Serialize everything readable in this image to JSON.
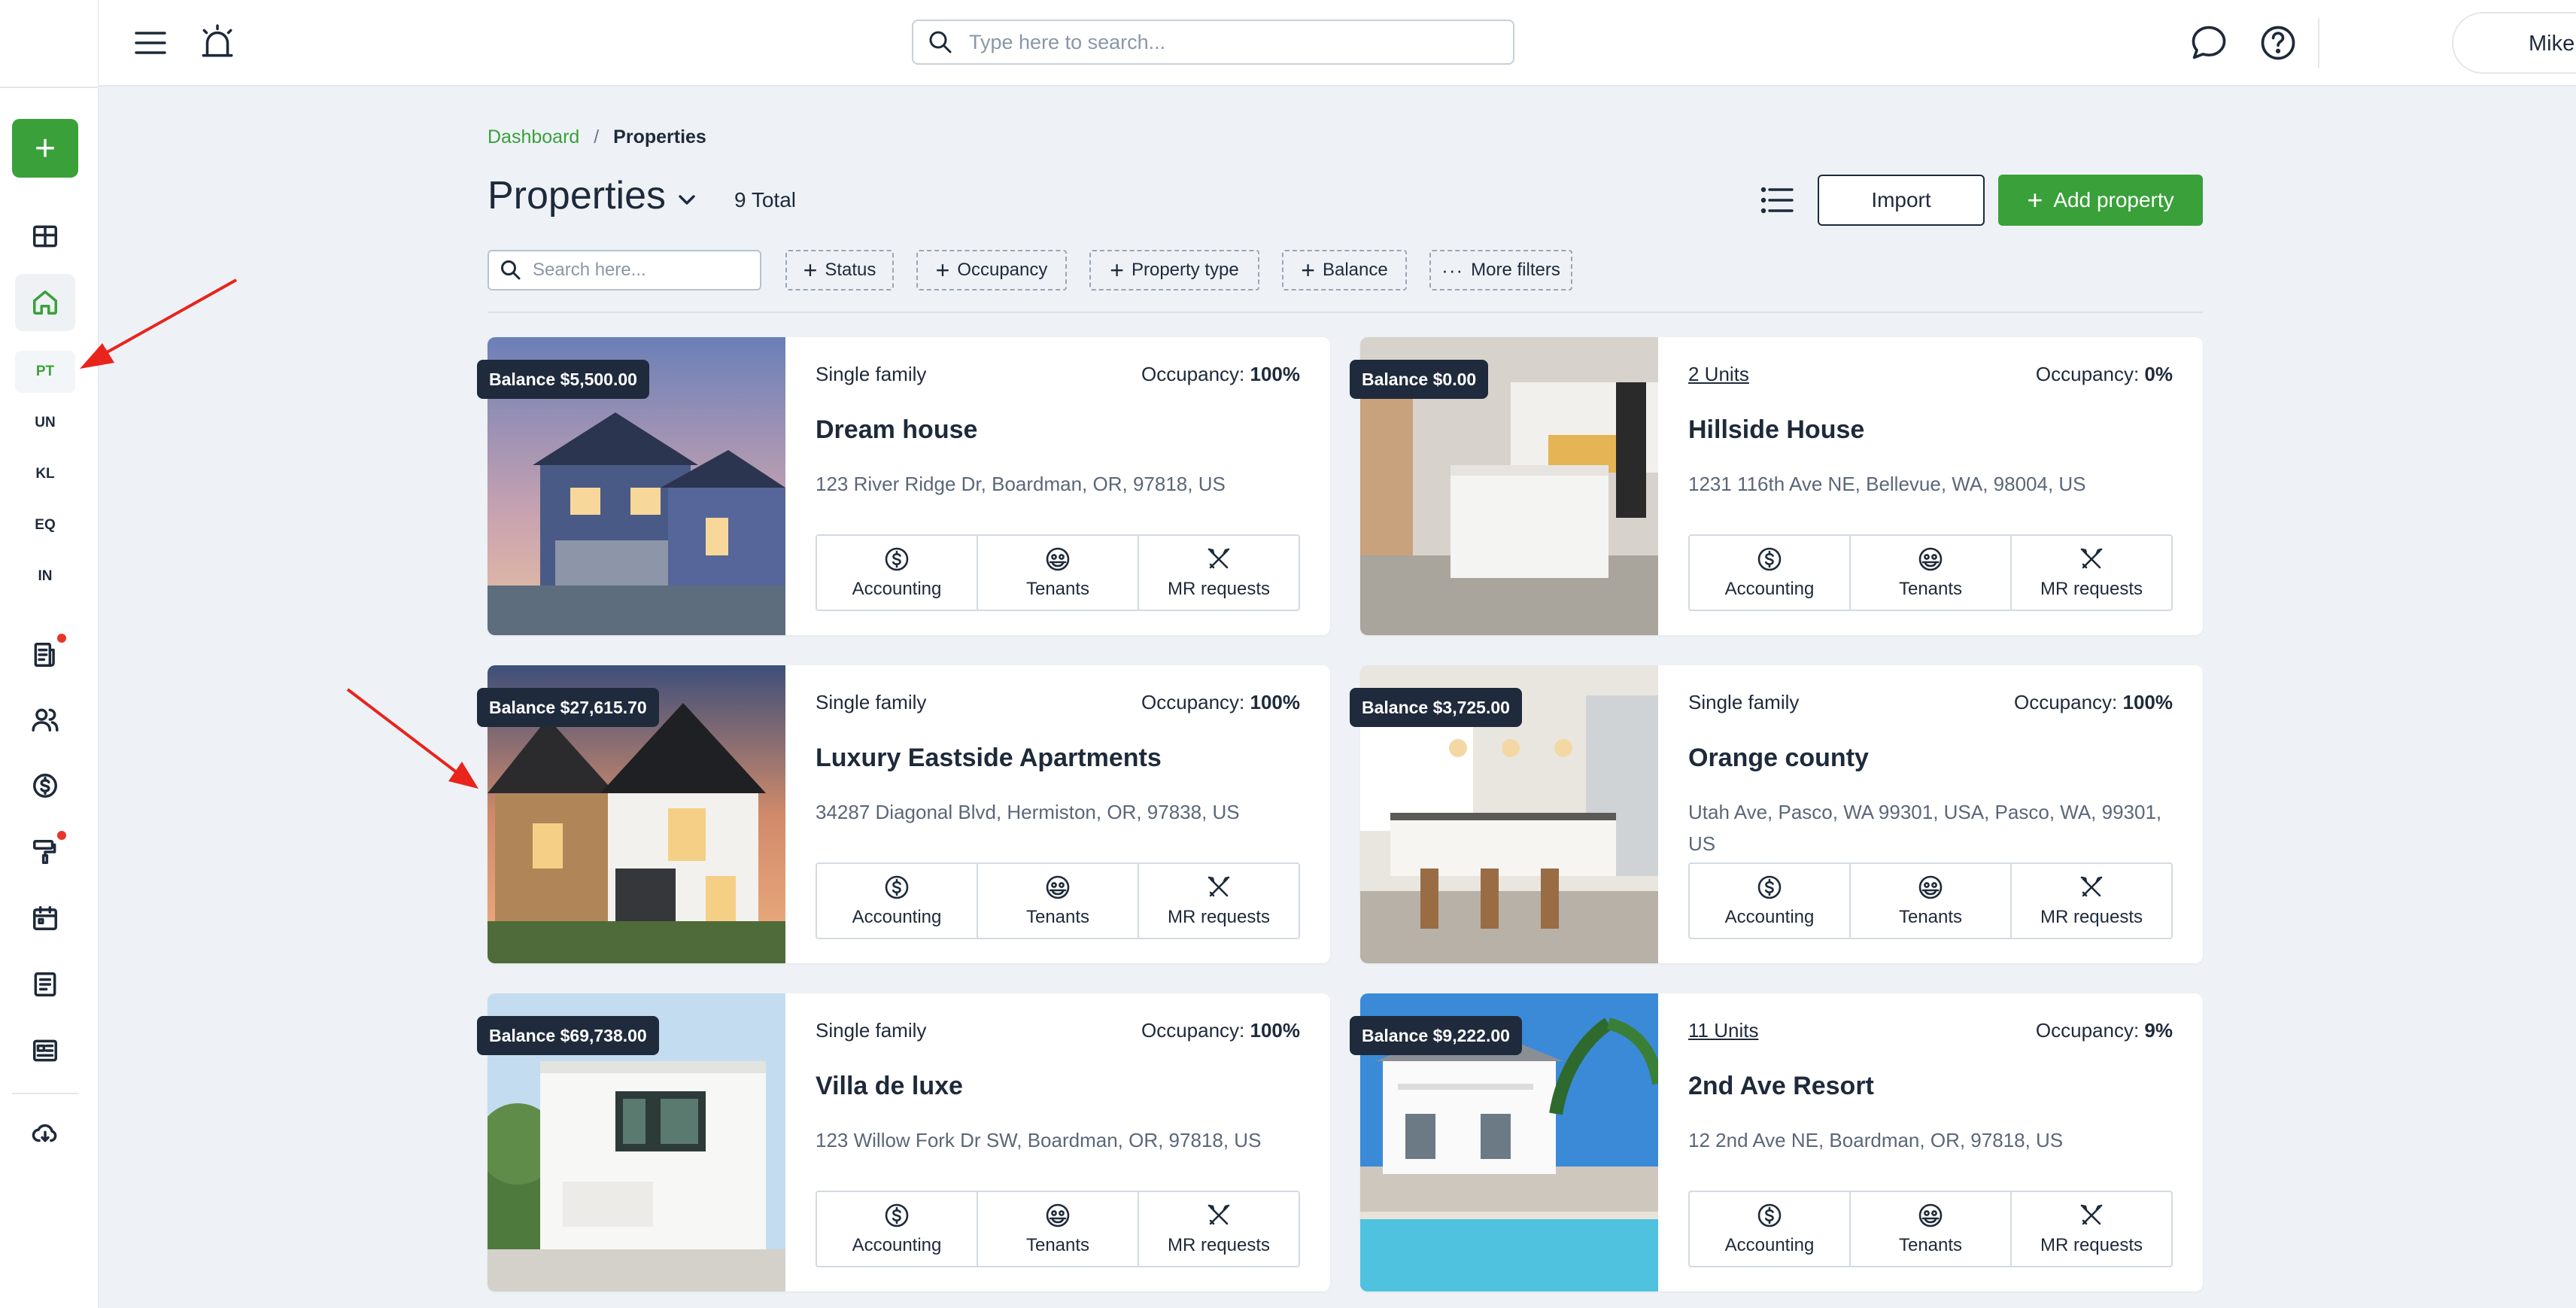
{
  "sidebar": {
    "add_label": "+",
    "items": [
      {
        "name": "dashboard",
        "icon": "grid-icon"
      },
      {
        "name": "properties",
        "icon": "home-icon",
        "active": true
      }
    ],
    "sub_items": [
      {
        "label": "PT",
        "active": true
      },
      {
        "label": "UN"
      },
      {
        "label": "KL"
      },
      {
        "label": "EQ"
      },
      {
        "label": "IN"
      }
    ],
    "lower_icons": [
      "document-icon",
      "users-icon",
      "dollar-icon",
      "paint-roller-icon",
      "calendar-icon",
      "notes-icon",
      "newspaper-icon",
      "cloud-download-icon"
    ]
  },
  "topbar": {
    "search_placeholder": "Type here to search...",
    "user_name": "Mike"
  },
  "breadcrumb": {
    "parent": "Dashboard",
    "separator": "/",
    "current": "Properties"
  },
  "header": {
    "title": "Properties",
    "total": "9 Total",
    "import_label": "Import",
    "add_label": "Add property"
  },
  "filters": {
    "search_placeholder": "Search here...",
    "chips": [
      "Status",
      "Occupancy",
      "Property type",
      "Balance"
    ],
    "more_label": "More filters"
  },
  "properties": [
    {
      "balance": "Balance $5,500.00",
      "type": "Single family",
      "type_link": false,
      "occupancy_label": "Occupancy:",
      "occupancy": "100%",
      "name": "Dream house",
      "address": "123 River Ridge Dr, Boardman, OR, 97818, US"
    },
    {
      "balance": "Balance $0.00",
      "type": "2 Units",
      "type_link": true,
      "occupancy_label": "Occupancy:",
      "occupancy": "0%",
      "name": "Hillside House",
      "address": "1231 116th Ave NE, Bellevue, WA, 98004, US"
    },
    {
      "balance": "Balance $27,615.70",
      "type": "Single family",
      "type_link": false,
      "occupancy_label": "Occupancy:",
      "occupancy": "100%",
      "name": "Luxury Eastside Apartments",
      "address": "34287 Diagonal Blvd, Hermiston, OR, 97838, US"
    },
    {
      "balance": "Balance $3,725.00",
      "type": "Single family",
      "type_link": false,
      "occupancy_label": "Occupancy:",
      "occupancy": "100%",
      "name": "Orange county",
      "address": "Utah Ave, Pasco, WA 99301, USA, Pasco, WA, 99301, US"
    },
    {
      "balance": "Balance $69,738.00",
      "type": "Single family",
      "type_link": false,
      "occupancy_label": "Occupancy:",
      "occupancy": "100%",
      "name": "Villa de luxe",
      "address": "123 Willow Fork Dr SW, Boardman, OR, 97818, US"
    },
    {
      "balance": "Balance $9,222.00",
      "type": "11 Units",
      "type_link": true,
      "occupancy_label": "Occupancy:",
      "occupancy": "9%",
      "name": "2nd Ave Resort",
      "address": "12 2nd Ave NE, Boardman, OR, 97818, US"
    }
  ],
  "card_actions": {
    "accounting": "Accounting",
    "tenants": "Tenants",
    "mr_requests": "MR requests"
  },
  "colors": {
    "brand_green": "#3aa03a",
    "navy": "#1f2a3c",
    "annotation_red": "#e8241c",
    "notification_dot": "#e8352c"
  }
}
